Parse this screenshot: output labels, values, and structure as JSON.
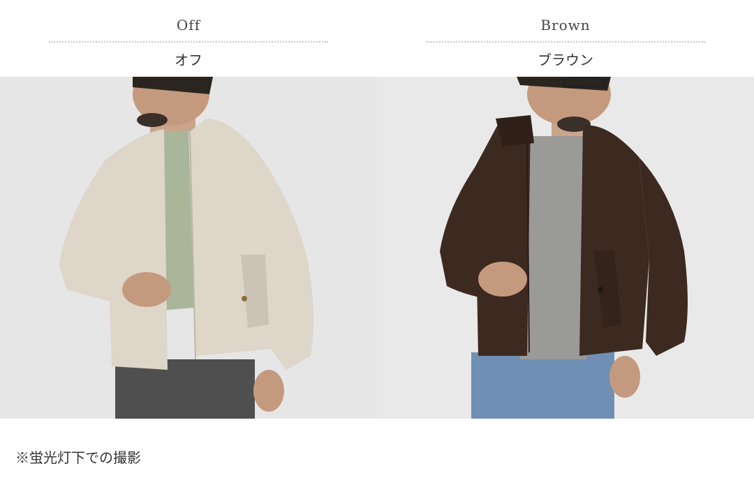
{
  "variants": [
    {
      "name_en": "Off",
      "name_jp": "オフ",
      "jacket_color": "#ddd6c9",
      "shirt_color": "#a9b69a",
      "pants_color": "#4f4f4f",
      "background": "#e6e6e6"
    },
    {
      "name_en": "Brown",
      "name_jp": "ブラウン",
      "jacket_color": "#3c2a20",
      "shirt_color": "#9a9a98",
      "pants_color": "#6f8fb4",
      "background": "#e9e9e9"
    }
  ],
  "footnote": "※蛍光灯下での撮影"
}
